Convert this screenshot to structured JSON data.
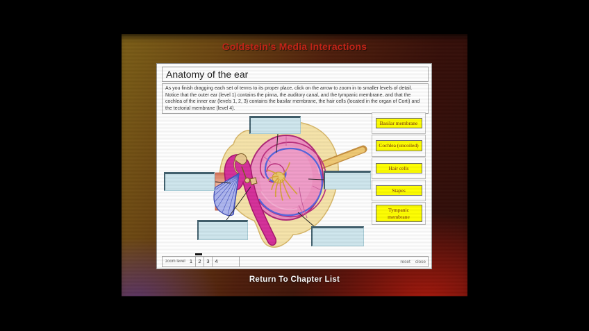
{
  "header": {
    "title": "Goldstein's Media Interactions"
  },
  "panel": {
    "title": "Anatomy of the ear",
    "instructions": "As you finish dragging each set of terms to its proper place, click on the arrow to zoom in to smaller levels of detail. Notice that the outer ear (level 1) contains the pinna, the auditory canal, and the tympanic membrane, and that the cochlea of the inner ear (levels 1, 2, 3) contains the basilar membrane, the hair cells (located in the organ of Corti) and the tectorial membrane (level 4).",
    "diagram_alt": "Cross-section diagram of the middle and inner ear with cochlea, eardrum and ossicles"
  },
  "terms": [
    {
      "label": "Basilar membrane"
    },
    {
      "label": "Cochlea (uncoiled)"
    },
    {
      "label": "Hair cells"
    },
    {
      "label": "Stapes"
    },
    {
      "label": "Tympanic membrane"
    }
  ],
  "zoom_bar": {
    "label": "zoom level",
    "levels": [
      "1",
      "2",
      "3",
      "4"
    ],
    "current_level": "2",
    "reset_label": "reset",
    "close_label": "close"
  },
  "footer": {
    "return_link": "Return To Chapter List"
  },
  "colors": {
    "accent_red": "#c62417",
    "term_yellow": "#ffff00",
    "drop_box_blue": "#cfe7ee",
    "cochlea_pink": "#ef92c2",
    "membrane_blue": "#5565de"
  }
}
